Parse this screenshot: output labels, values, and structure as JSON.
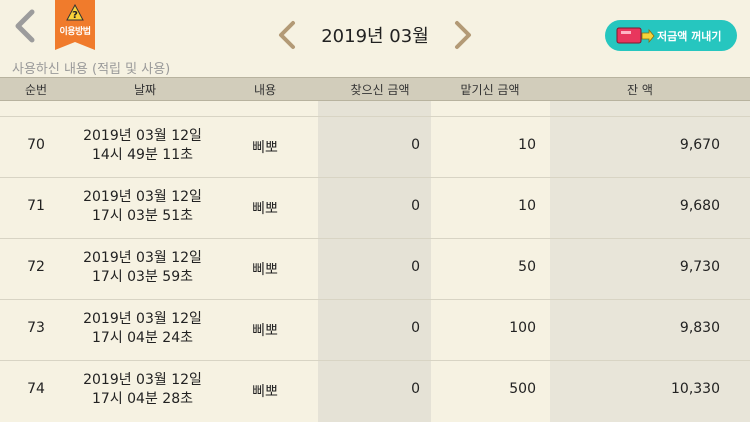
{
  "header": {
    "guide_label": "이용방법",
    "month": "2019년 03월",
    "withdraw_label": "저금액 꺼내기"
  },
  "subtitle": "사용하신 내용 (적립 및 사용)",
  "table": {
    "columns": [
      "순번",
      "날짜",
      "내용",
      "찾으신 금액",
      "맡기신 금액",
      "잔 액"
    ],
    "rows": [
      {
        "no": "70",
        "date1": "2019년 03월 12일",
        "date2": "14시 49분 11초",
        "desc": "삐뽀",
        "out": "0",
        "in": "10",
        "balance": "9,670"
      },
      {
        "no": "71",
        "date1": "2019년 03월 12일",
        "date2": "17시 03분 51초",
        "desc": "삐뽀",
        "out": "0",
        "in": "10",
        "balance": "9,680"
      },
      {
        "no": "72",
        "date1": "2019년 03월 12일",
        "date2": "17시 03분 59초",
        "desc": "삐뽀",
        "out": "0",
        "in": "50",
        "balance": "9,730"
      },
      {
        "no": "73",
        "date1": "2019년 03월 12일",
        "date2": "17시 04분 24초",
        "desc": "삐뽀",
        "out": "0",
        "in": "100",
        "balance": "9,830"
      },
      {
        "no": "74",
        "date1": "2019년 03월 12일",
        "date2": "17시 04분 28초",
        "desc": "삐뽀",
        "out": "0",
        "in": "500",
        "balance": "10,330"
      }
    ]
  },
  "colors": {
    "background": "#f6f2e2",
    "header_row": "#d2cdbb",
    "accent": "#26c6bf",
    "badge": "#f07b2c"
  }
}
